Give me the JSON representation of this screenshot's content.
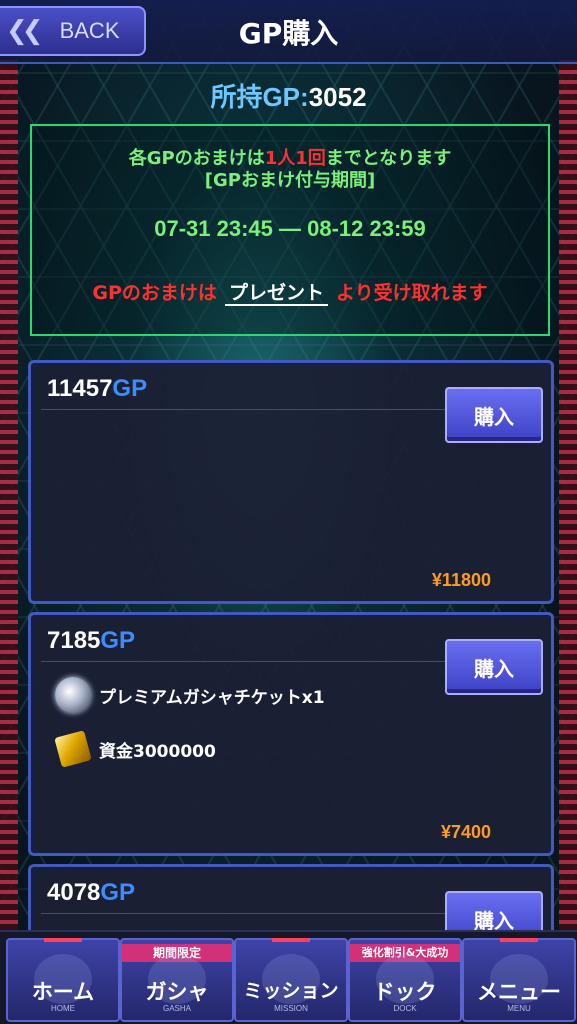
{
  "header": {
    "back_label": "BACK",
    "back_icon": "double-chevron-left-icon",
    "title": "GP購入"
  },
  "balance": {
    "label": "所持GP:",
    "value": "3052"
  },
  "info": {
    "line1_prefix": "各GPのおまけは",
    "line1_highlight": "1人1回",
    "line1_suffix": "までとなります",
    "line2": "[GPおまけ付与期間]",
    "period": "07-31 23:45 ― 08-12 23:59",
    "present_prefix": "GPのおまけは",
    "present_link": "プレゼント",
    "present_suffix": "より受け取れます"
  },
  "products": [
    {
      "amount": "11457",
      "unit": "GP",
      "buy_label": "購入",
      "price": "¥11800",
      "rewards": []
    },
    {
      "amount": "7185",
      "unit": "GP",
      "buy_label": "購入",
      "price": "¥7400",
      "rewards": [
        {
          "icon": "gacha-ticket-icon",
          "label": "プレミアムガシャチケットx1"
        },
        {
          "icon": "gold-bar-icon",
          "label": "資金3000000"
        }
      ]
    },
    {
      "amount": "4078",
      "unit": "GP",
      "buy_label": "購入"
    }
  ],
  "nav": [
    {
      "label": "ホーム",
      "sub": "HOME",
      "badge": ""
    },
    {
      "label": "ガシャ",
      "sub": "GASHA",
      "badge": "期間限定"
    },
    {
      "label": "ミッション",
      "sub": "MISSION",
      "badge": ""
    },
    {
      "label": "ドック",
      "sub": "DOCK",
      "badge": "強化割引&大成功"
    },
    {
      "label": "メニュー",
      "sub": "MENU",
      "badge": ""
    }
  ],
  "colors": {
    "accent_blue": "#3d8cff",
    "price_orange": "#ff9c1e",
    "notice_green": "#7cf07a",
    "notice_red": "#ff3030"
  }
}
